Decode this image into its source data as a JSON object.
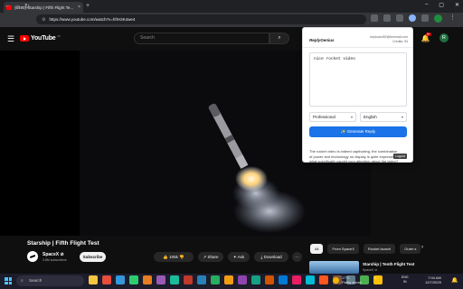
{
  "browser": {
    "tab_title": "(6490) Starship | Fifth Flight Te...",
    "tab_close": "×",
    "new_tab": "+",
    "url": "https://www.youtube.com/watch?v=hfIH3K4we4",
    "window_controls": [
      "–",
      "▢",
      "✕"
    ],
    "nav": [
      "←",
      "→",
      "↻"
    ],
    "profile_letter": "",
    "menu": "⋮"
  },
  "youtube": {
    "logo_text": "YouTube",
    "logo_country": "IN",
    "search_placeholder": "Search",
    "notification_count": "9+",
    "avatar_letter": "R",
    "video_title": "Starship | Fifth Flight Test",
    "channel_name": "SpaceX ⊘",
    "channel_subs": "3.8M subscribers",
    "subscribe_label": "Subscribe",
    "like_count": "105k",
    "share_label": "Share",
    "ask_label": "Ask",
    "download_label": "Download",
    "more_label": "···",
    "chips": [
      "All",
      "From SpaceX",
      "Rocket launch",
      "Outer s"
    ],
    "chip_next": "›",
    "rec_title": "Starship | Tenth Flight Test",
    "rec_channel": "SpaceX ⊘"
  },
  "popup": {
    "brand": "ReplyGenius",
    "account_email": "keyboard92@benmail.com",
    "credits": "Credits: 94",
    "input_text": "nice rocket video",
    "tone": "Professional",
    "language": "English",
    "generate_label": "✨ Generate Reply",
    "reply_text": "The rocket video is indeed captivating, the combination of power and technology on display is quite impressive. what specifically caught your attention about the video?",
    "logout_label": "Logout"
  },
  "taskbar": {
    "search_placeholder": "Search",
    "weather_temp": "17°C",
    "weather_desc": "Partly sunny",
    "tray": "^",
    "lang_top": "ENG",
    "lang_bottom": "IN",
    "time": "7:04 AM",
    "date": "12/7/2025",
    "icon_colors": [
      "#f5c542",
      "#e74c3c",
      "#3498db",
      "#2ecc71",
      "#e67e22",
      "#9b59b6",
      "#1abc9c",
      "#c0392b",
      "#2980b9",
      "#27ae60",
      "#f39c12",
      "#8e44ad",
      "#16a085",
      "#d35400",
      "#0078d4",
      "#e91e63",
      "#00bcd4",
      "#ff5722",
      "#795548",
      "#607d8b",
      "#4caf50",
      "#ffc107"
    ]
  },
  "colors": {
    "yt_red": "#ff0000",
    "popup_button": "#1a73e8"
  }
}
